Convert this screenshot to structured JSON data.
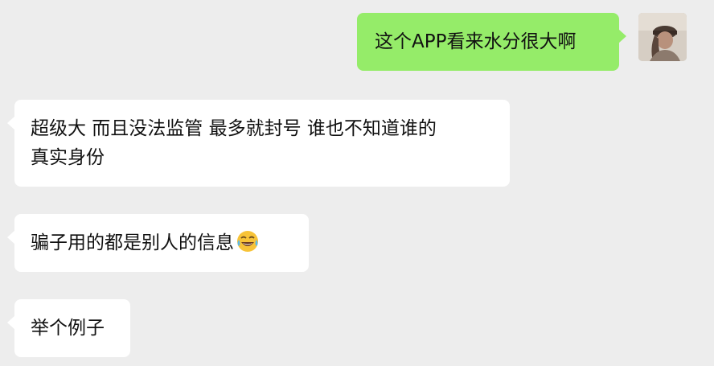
{
  "conversation": {
    "messages": [
      {
        "direction": "outgoing",
        "lines": [
          "这个APP看来水分很大啊"
        ]
      },
      {
        "direction": "incoming",
        "lines": [
          "超级大 而且没法监管 最多就封号 谁也不知道谁的",
          "真实身份"
        ]
      },
      {
        "direction": "incoming",
        "lines": [
          "骗子用的都是别人的信息"
        ],
        "emoji": "tears-of-joy-emoji-icon"
      },
      {
        "direction": "incoming",
        "lines": [
          "举个例子"
        ]
      }
    ]
  },
  "colors": {
    "background": "#ededed",
    "incoming_bubble": "#ffffff",
    "outgoing_bubble": "#95ec69",
    "text": "#111111"
  },
  "avatar_icon": "user-avatar-photo"
}
